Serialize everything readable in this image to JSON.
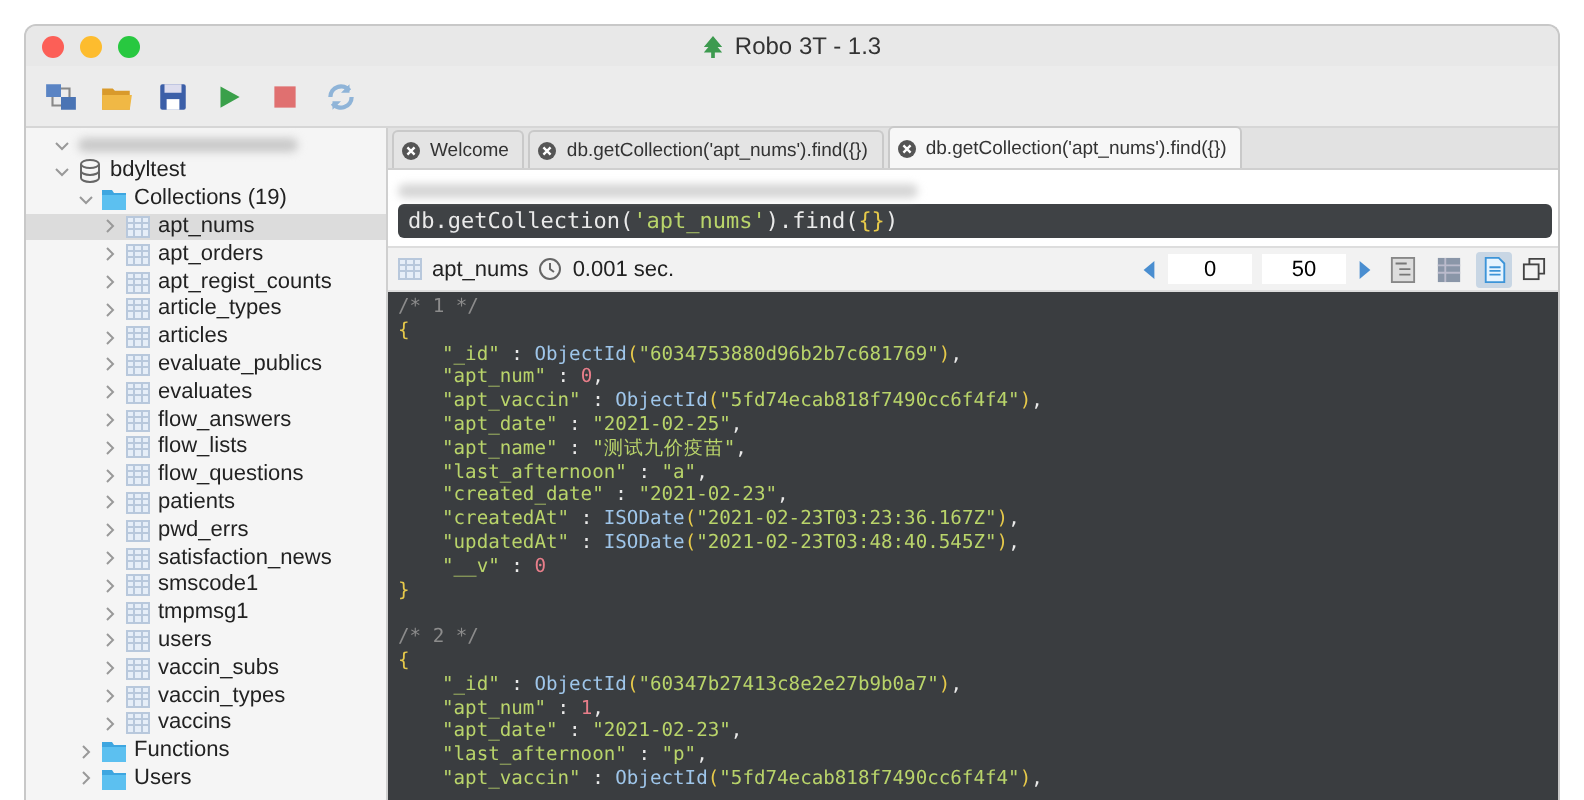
{
  "window": {
    "title": "Robo 3T - 1.3"
  },
  "toolbar": [
    {
      "kind": "connect"
    },
    {
      "kind": "open"
    },
    {
      "kind": "save"
    },
    {
      "kind": "run"
    },
    {
      "kind": "stop"
    },
    {
      "kind": "refresh"
    }
  ],
  "tree": [
    {
      "label": "bdyltest",
      "kind": "database",
      "expanded": true,
      "children": [
        {
          "label": "Collections (19)",
          "kind": "folder",
          "expanded": true,
          "children": [
            {
              "label": "apt_nums",
              "kind": "collection",
              "selected": true
            },
            {
              "label": "apt_orders",
              "kind": "collection",
              "selected": false
            },
            {
              "label": "apt_regist_counts",
              "kind": "collection",
              "selected": false
            },
            {
              "label": "article_types",
              "kind": "collection",
              "selected": false
            },
            {
              "label": "articles",
              "kind": "collection",
              "selected": false
            },
            {
              "label": "evaluate_publics",
              "kind": "collection",
              "selected": false
            },
            {
              "label": "evaluates",
              "kind": "collection",
              "selected": false
            },
            {
              "label": "flow_answers",
              "kind": "collection",
              "selected": false
            },
            {
              "label": "flow_lists",
              "kind": "collection",
              "selected": false
            },
            {
              "label": "flow_questions",
              "kind": "collection",
              "selected": false
            },
            {
              "label": "patients",
              "kind": "collection",
              "selected": false
            },
            {
              "label": "pwd_errs",
              "kind": "collection",
              "selected": false
            },
            {
              "label": "satisfaction_news",
              "kind": "collection",
              "selected": false
            },
            {
              "label": "smscode1",
              "kind": "collection",
              "selected": false
            },
            {
              "label": "tmpmsg1",
              "kind": "collection",
              "selected": false
            },
            {
              "label": "users",
              "kind": "collection",
              "selected": false
            },
            {
              "label": "vaccin_subs",
              "kind": "collection",
              "selected": false
            },
            {
              "label": "vaccin_types",
              "kind": "collection",
              "selected": false
            },
            {
              "label": "vaccins",
              "kind": "collection",
              "selected": false
            }
          ]
        },
        {
          "label": "Functions",
          "kind": "folder",
          "expanded": false
        },
        {
          "label": "Users",
          "kind": "folder",
          "expanded": false
        }
      ]
    }
  ],
  "tabs": [
    {
      "label": "Welcome",
      "selected": false
    },
    {
      "label": "db.getCollection('apt_nums').find({})",
      "selected": false
    },
    {
      "label": "db.getCollection('apt_nums').find({})",
      "selected": true
    }
  ],
  "query": [
    {
      "kind": "plain",
      "text": "db.getCollection("
    },
    {
      "kind": "string",
      "text": "'apt_nums'"
    },
    {
      "kind": "plain",
      "text": ").find("
    },
    {
      "kind": "brace",
      "text": "{}"
    },
    {
      "kind": "plain",
      "text": ")"
    }
  ],
  "results_bar": {
    "collection": "apt_nums",
    "time": "0.001 sec.",
    "skip": "0",
    "limit": "50",
    "views": [
      {
        "kind": "tree",
        "selected": false
      },
      {
        "kind": "table",
        "selected": false
      },
      {
        "kind": "text",
        "selected": true
      }
    ]
  },
  "code": [
    {
      "indent": false,
      "tokens": [
        {
          "kind": "comment",
          "text": "/* 1 */"
        }
      ]
    },
    {
      "indent": false,
      "tokens": [
        {
          "kind": "brace",
          "text": "{"
        }
      ]
    },
    {
      "indent": true,
      "tokens": [
        {
          "kind": "key",
          "text": "\"_id\""
        },
        {
          "kind": "punct",
          "text": " : "
        },
        {
          "kind": "func",
          "text": "ObjectId"
        },
        {
          "kind": "brace",
          "text": "("
        },
        {
          "kind": "string",
          "text": "\"6034753880d96b2b7c681769\""
        },
        {
          "kind": "brace",
          "text": ")"
        },
        {
          "kind": "punct",
          "text": ","
        }
      ]
    },
    {
      "indent": true,
      "tokens": [
        {
          "kind": "key",
          "text": "\"apt_num\""
        },
        {
          "kind": "punct",
          "text": " : "
        },
        {
          "kind": "number",
          "text": "0"
        },
        {
          "kind": "punct",
          "text": ","
        }
      ]
    },
    {
      "indent": true,
      "tokens": [
        {
          "kind": "key",
          "text": "\"apt_vaccin\""
        },
        {
          "kind": "punct",
          "text": " : "
        },
        {
          "kind": "func",
          "text": "ObjectId"
        },
        {
          "kind": "brace",
          "text": "("
        },
        {
          "kind": "string",
          "text": "\"5fd74ecab818f7490cc6f4f4\""
        },
        {
          "kind": "brace",
          "text": ")"
        },
        {
          "kind": "punct",
          "text": ","
        }
      ]
    },
    {
      "indent": true,
      "tokens": [
        {
          "kind": "key",
          "text": "\"apt_date\""
        },
        {
          "kind": "punct",
          "text": " : "
        },
        {
          "kind": "string",
          "text": "\"2021-02-25\""
        },
        {
          "kind": "punct",
          "text": ","
        }
      ]
    },
    {
      "indent": true,
      "tokens": [
        {
          "kind": "key",
          "text": "\"apt_name\""
        },
        {
          "kind": "punct",
          "text": " : "
        },
        {
          "kind": "string",
          "text": "\"测试九价疫苗\""
        },
        {
          "kind": "punct",
          "text": ","
        }
      ]
    },
    {
      "indent": true,
      "tokens": [
        {
          "kind": "key",
          "text": "\"last_afternoon\""
        },
        {
          "kind": "punct",
          "text": " : "
        },
        {
          "kind": "string",
          "text": "\"a\""
        },
        {
          "kind": "punct",
          "text": ","
        }
      ]
    },
    {
      "indent": true,
      "tokens": [
        {
          "kind": "key",
          "text": "\"created_date\""
        },
        {
          "kind": "punct",
          "text": " : "
        },
        {
          "kind": "string",
          "text": "\"2021-02-23\""
        },
        {
          "kind": "punct",
          "text": ","
        }
      ]
    },
    {
      "indent": true,
      "tokens": [
        {
          "kind": "key",
          "text": "\"createdAt\""
        },
        {
          "kind": "punct",
          "text": " : "
        },
        {
          "kind": "func",
          "text": "ISODate"
        },
        {
          "kind": "brace",
          "text": "("
        },
        {
          "kind": "string",
          "text": "\"2021-02-23T03:23:36.167Z\""
        },
        {
          "kind": "brace",
          "text": ")"
        },
        {
          "kind": "punct",
          "text": ","
        }
      ]
    },
    {
      "indent": true,
      "tokens": [
        {
          "kind": "key",
          "text": "\"updatedAt\""
        },
        {
          "kind": "punct",
          "text": " : "
        },
        {
          "kind": "func",
          "text": "ISODate"
        },
        {
          "kind": "brace",
          "text": "("
        },
        {
          "kind": "string",
          "text": "\"2021-02-23T03:48:40.545Z\""
        },
        {
          "kind": "brace",
          "text": ")"
        },
        {
          "kind": "punct",
          "text": ","
        }
      ]
    },
    {
      "indent": true,
      "tokens": [
        {
          "kind": "key",
          "text": "\"__v\""
        },
        {
          "kind": "punct",
          "text": " : "
        },
        {
          "kind": "number",
          "text": "0"
        }
      ]
    },
    {
      "indent": false,
      "tokens": [
        {
          "kind": "brace",
          "text": "}"
        }
      ]
    },
    {
      "indent": false,
      "gap_before": true,
      "tokens": [
        {
          "kind": "comment",
          "text": "/* 2 */"
        }
      ]
    },
    {
      "indent": false,
      "tokens": [
        {
          "kind": "brace",
          "text": "{"
        }
      ]
    },
    {
      "indent": true,
      "tokens": [
        {
          "kind": "key",
          "text": "\"_id\""
        },
        {
          "kind": "punct",
          "text": " : "
        },
        {
          "kind": "func",
          "text": "ObjectId"
        },
        {
          "kind": "brace",
          "text": "("
        },
        {
          "kind": "string",
          "text": "\"60347b27413c8e2e27b9b0a7\""
        },
        {
          "kind": "brace",
          "text": ")"
        },
        {
          "kind": "punct",
          "text": ","
        }
      ]
    },
    {
      "indent": true,
      "tokens": [
        {
          "kind": "key",
          "text": "\"apt_num\""
        },
        {
          "kind": "punct",
          "text": " : "
        },
        {
          "kind": "number",
          "text": "1"
        },
        {
          "kind": "punct",
          "text": ","
        }
      ]
    },
    {
      "indent": true,
      "tokens": [
        {
          "kind": "key",
          "text": "\"apt_date\""
        },
        {
          "kind": "punct",
          "text": " : "
        },
        {
          "kind": "string",
          "text": "\"2021-02-23\""
        },
        {
          "kind": "punct",
          "text": ","
        }
      ]
    },
    {
      "indent": true,
      "tokens": [
        {
          "kind": "key",
          "text": "\"last_afternoon\""
        },
        {
          "kind": "punct",
          "text": " : "
        },
        {
          "kind": "string",
          "text": "\"p\""
        },
        {
          "kind": "punct",
          "text": ","
        }
      ]
    },
    {
      "indent": true,
      "tokens": [
        {
          "kind": "key",
          "text": "\"apt_vaccin\""
        },
        {
          "kind": "punct",
          "text": " : "
        },
        {
          "kind": "func",
          "text": "ObjectId"
        },
        {
          "kind": "brace",
          "text": "("
        },
        {
          "kind": "string",
          "text": "\"5fd74ecab818f7490cc6f4f4\""
        },
        {
          "kind": "brace",
          "text": ")"
        },
        {
          "kind": "punct",
          "text": ","
        }
      ]
    }
  ]
}
